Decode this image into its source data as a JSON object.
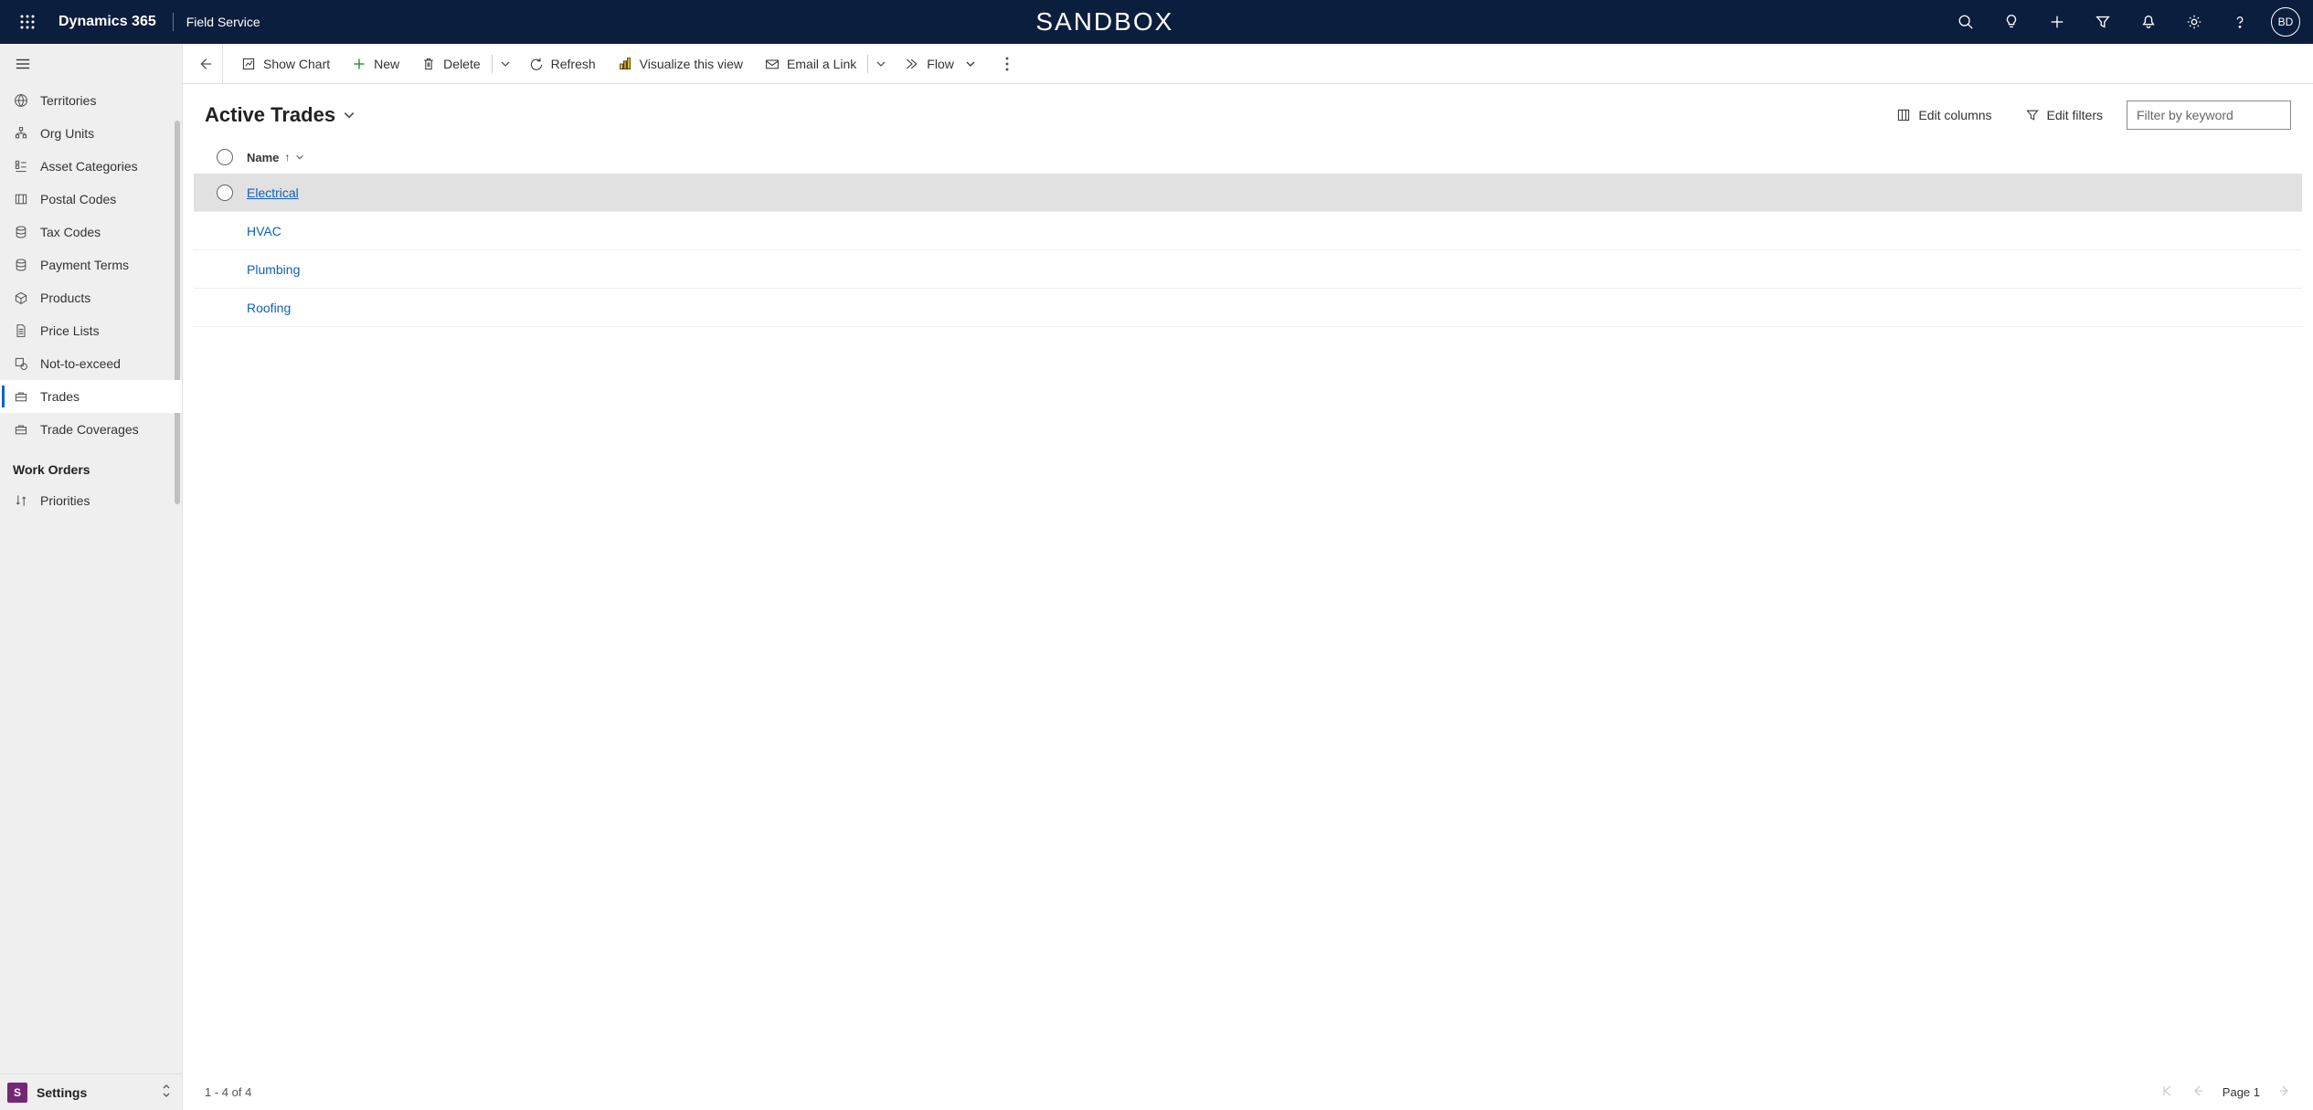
{
  "header": {
    "brand": "Dynamics 365",
    "app": "Field Service",
    "env": "SANDBOX",
    "avatar": "BD"
  },
  "sidebar": {
    "items": [
      {
        "label": "Territories"
      },
      {
        "label": "Org Units"
      },
      {
        "label": "Asset Categories"
      },
      {
        "label": "Postal Codes"
      },
      {
        "label": "Tax Codes"
      },
      {
        "label": "Payment Terms"
      },
      {
        "label": "Products"
      },
      {
        "label": "Price Lists"
      },
      {
        "label": "Not-to-exceed"
      },
      {
        "label": "Trades"
      },
      {
        "label": "Trade Coverages"
      }
    ],
    "section": "Work Orders",
    "wo_items": [
      {
        "label": "Priorities"
      }
    ],
    "area_badge": "S",
    "area_label": "Settings"
  },
  "commands": {
    "show_chart": "Show Chart",
    "new": "New",
    "delete": "Delete",
    "refresh": "Refresh",
    "visualize": "Visualize this view",
    "email_link": "Email a Link",
    "flow": "Flow"
  },
  "view": {
    "title": "Active Trades",
    "edit_columns": "Edit columns",
    "edit_filters": "Edit filters",
    "filter_placeholder": "Filter by keyword",
    "column": "Name",
    "rows": [
      "Electrical",
      "HVAC",
      "Plumbing",
      "Roofing"
    ],
    "count": "1 - 4 of 4",
    "page": "Page 1"
  }
}
